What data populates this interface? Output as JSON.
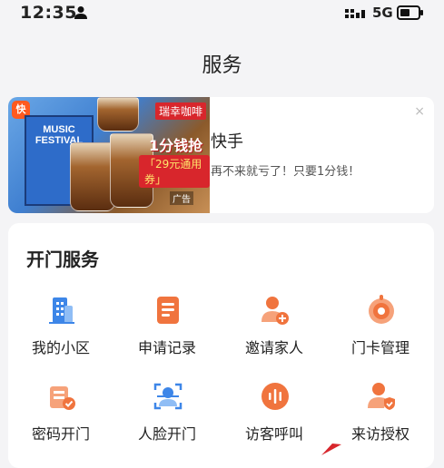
{
  "status_bar": {
    "time": "12:35",
    "network": "5G"
  },
  "page": {
    "title": "服务"
  },
  "ad": {
    "app_logo_text": "快手",
    "badge_text": "瑞幸咖啡",
    "festival_text": "MUSIC FESTIVAL",
    "promo_text": "1分钱抢",
    "coupon_text": "「29元通用券」",
    "ad_tag": "广告",
    "close_symbol": "×",
    "title": "快手",
    "description": "再不来就亏了！只要1分钱！"
  },
  "services": {
    "section_title": "开门服务",
    "items": [
      {
        "label": "我的小区",
        "icon": "building-icon"
      },
      {
        "label": "申请记录",
        "icon": "record-icon"
      },
      {
        "label": "邀请家人",
        "icon": "invite-family-icon"
      },
      {
        "label": "门卡管理",
        "icon": "door-card-icon"
      },
      {
        "label": "密码开门",
        "icon": "password-door-icon"
      },
      {
        "label": "人脸开门",
        "icon": "face-scan-icon"
      },
      {
        "label": "访客呼叫",
        "icon": "visitor-call-icon"
      },
      {
        "label": "来访授权",
        "icon": "visit-authorize-icon"
      }
    ]
  },
  "colors": {
    "accent_orange": "#f0743e",
    "accent_blue": "#3d86e8",
    "background": "#f4f4f6"
  }
}
